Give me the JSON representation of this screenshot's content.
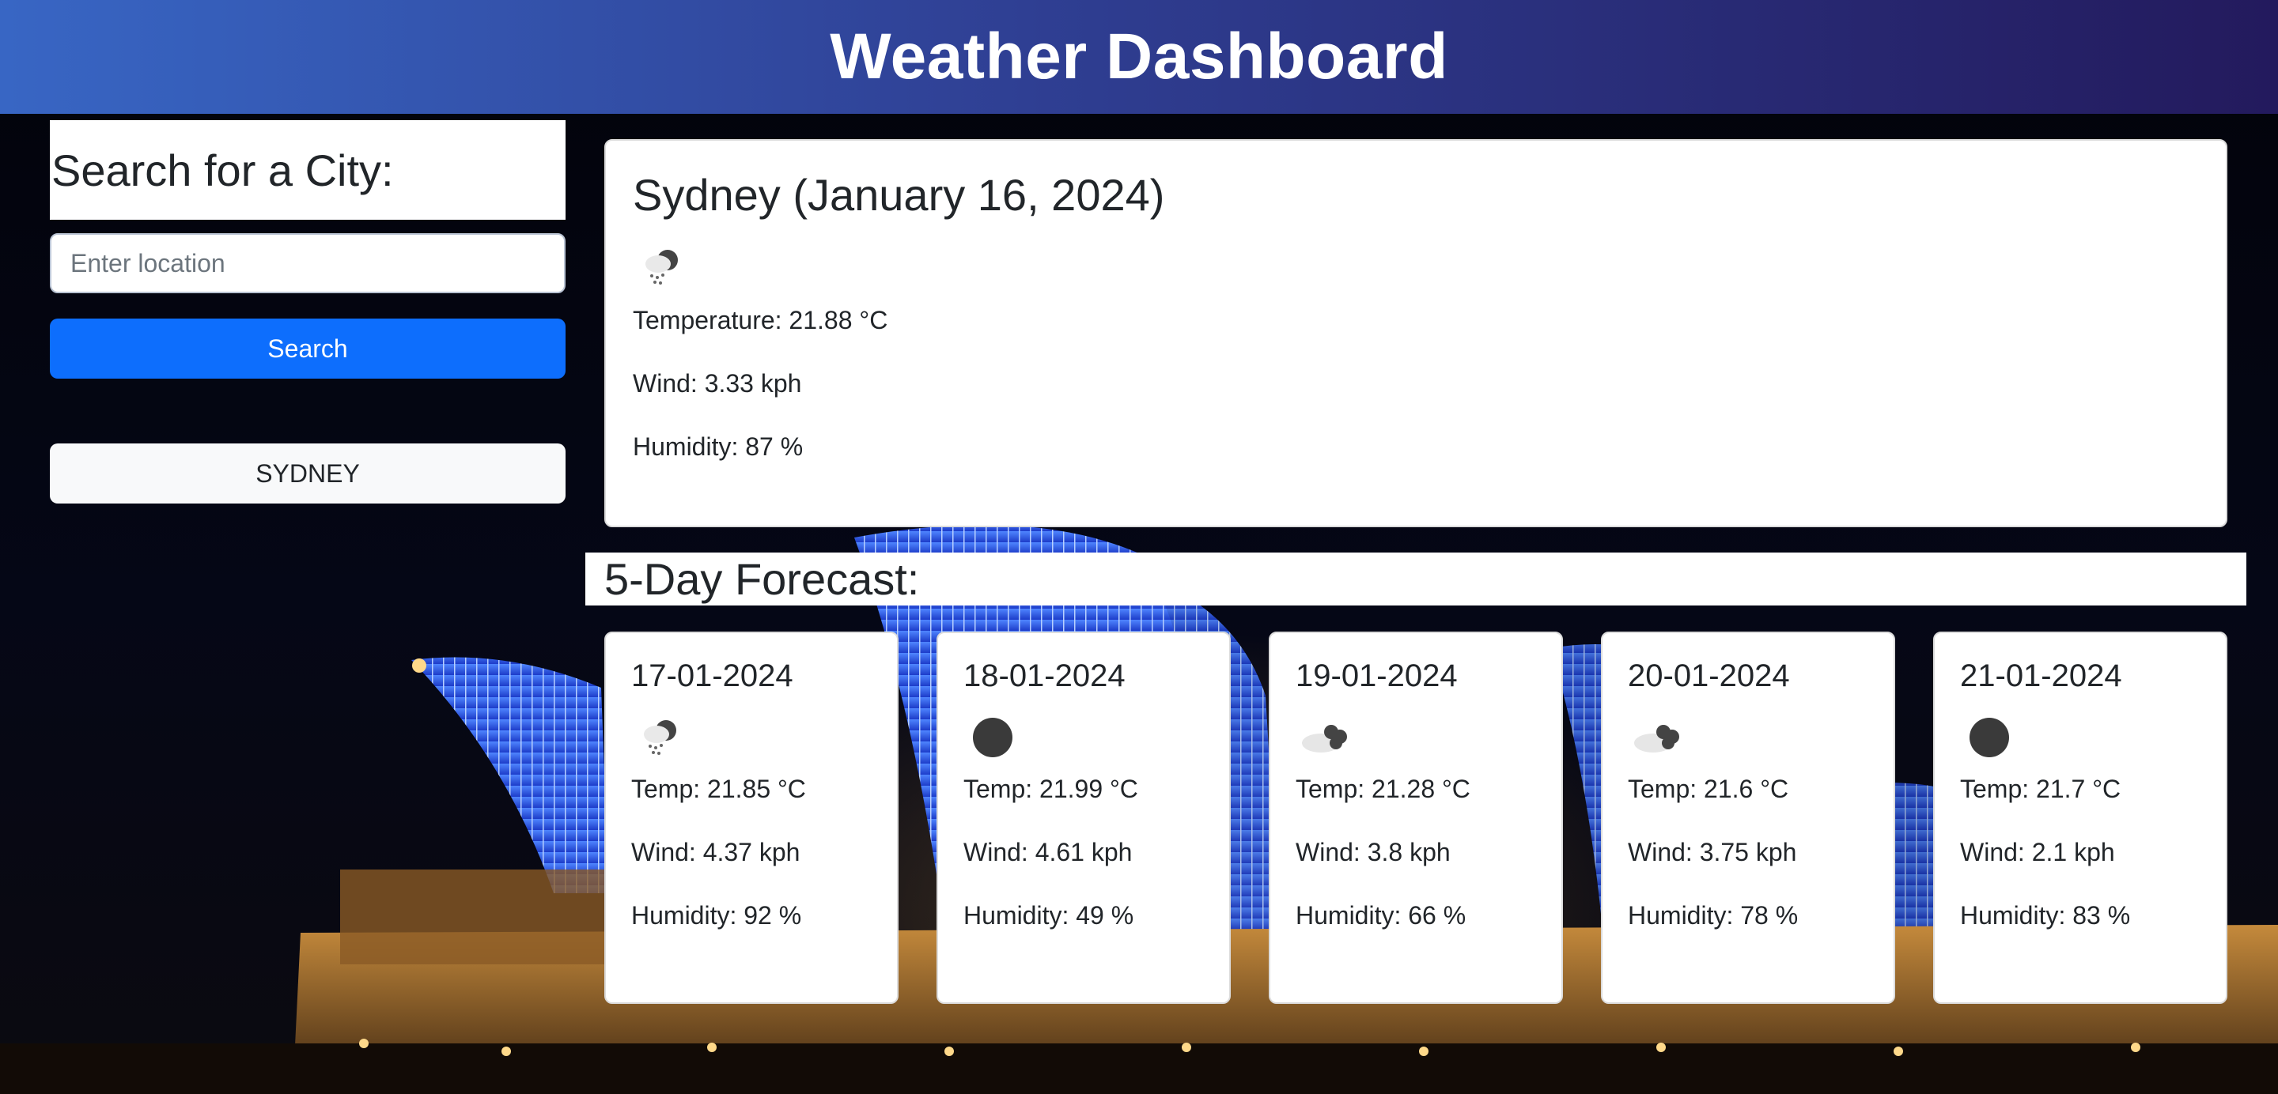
{
  "header": {
    "title": "Weather Dashboard"
  },
  "sidebar": {
    "heading": "Search for a City:",
    "search_placeholder": "Enter location",
    "search_value": "",
    "search_button_label": "Search",
    "history": [
      "SYDNEY"
    ]
  },
  "current": {
    "title": "Sydney (January 16, 2024)",
    "icon": "rain-cloud-icon",
    "temperature": "Temperature: 21.88 °C",
    "wind": "Wind: 3.33 kph",
    "humidity": "Humidity: 87 %"
  },
  "forecast": {
    "heading": "5-Day Forecast:",
    "days": [
      {
        "date": "17-01-2024",
        "icon": "rain-cloud-icon",
        "temp": "Temp: 21.85 °C",
        "wind": "Wind: 4.37 kph",
        "humidity": "Humidity: 92 %"
      },
      {
        "date": "18-01-2024",
        "icon": "overcast-icon",
        "temp": "Temp: 21.99 °C",
        "wind": "Wind: 4.61 kph",
        "humidity": "Humidity: 49 %"
      },
      {
        "date": "19-01-2024",
        "icon": "broken-clouds-icon",
        "temp": "Temp: 21.28 °C",
        "wind": "Wind: 3.8 kph",
        "humidity": "Humidity: 66 %"
      },
      {
        "date": "20-01-2024",
        "icon": "broken-clouds-icon",
        "temp": "Temp: 21.6 °C",
        "wind": "Wind: 3.75 kph",
        "humidity": "Humidity: 78 %"
      },
      {
        "date": "21-01-2024",
        "icon": "overcast-icon",
        "temp": "Temp: 21.7 °C",
        "wind": "Wind: 2.1 kph",
        "humidity": "Humidity: 83 %"
      }
    ]
  },
  "colors": {
    "header_start": "#3866c4",
    "header_end": "#231a5d",
    "search_button": "#0d6efd",
    "history_button": "#f8f9fa"
  }
}
